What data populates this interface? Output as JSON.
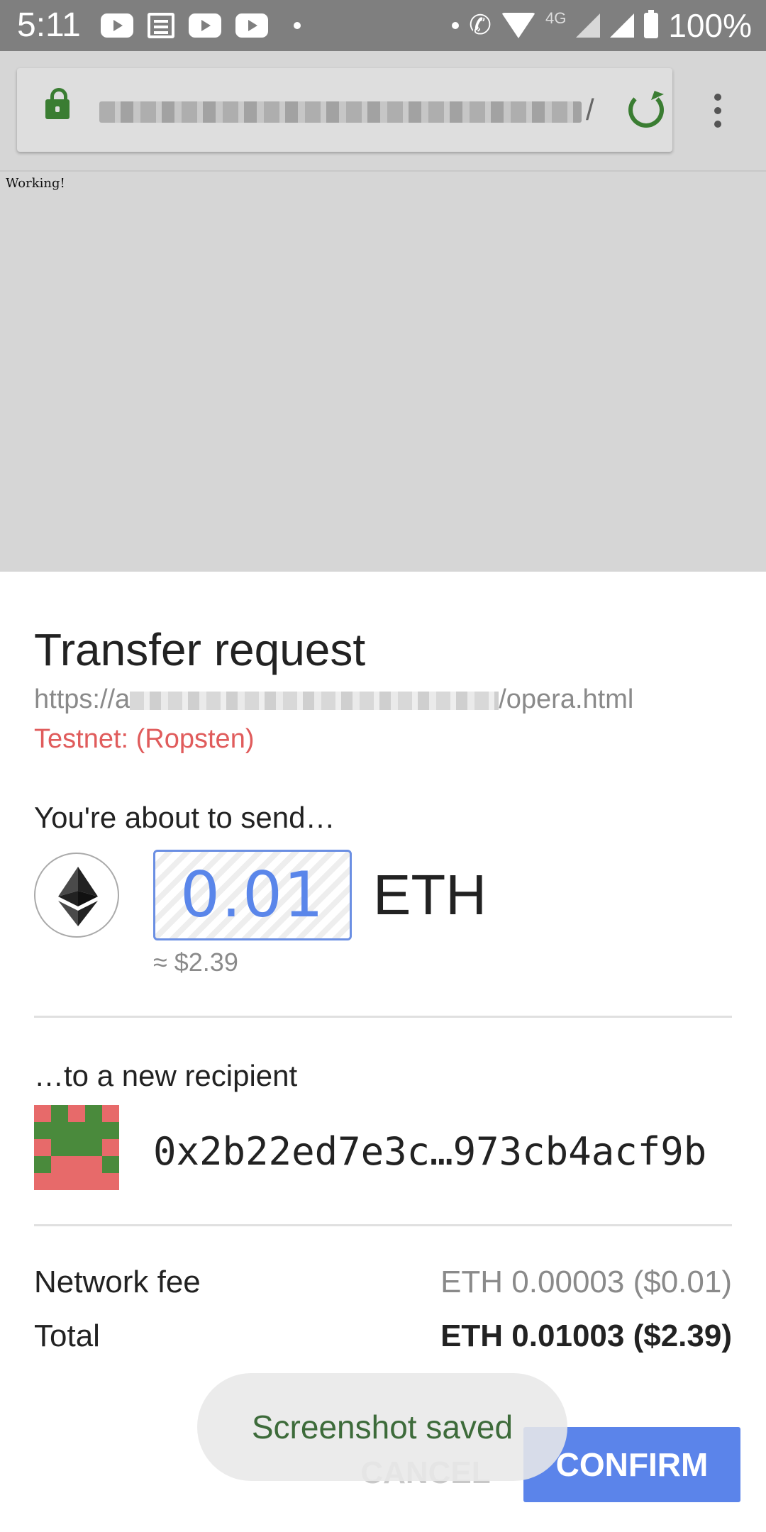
{
  "status_bar": {
    "time": "5:11",
    "network_type": "4G",
    "battery": "100%",
    "icons": [
      "youtube-icon",
      "news-icon",
      "youtube-icon",
      "youtube-icon",
      "dot-icon",
      "dot-icon",
      "wifi-call-icon",
      "wifi-icon",
      "signal-icon",
      "battery-icon"
    ]
  },
  "browser": {
    "url_suffix": "/",
    "secure": true,
    "page_text": "Working!",
    "icons": [
      "lock-icon",
      "reload-icon",
      "more-vert-icon"
    ]
  },
  "transfer": {
    "title": "Transfer request",
    "origin_prefix": "https://a",
    "origin_suffix": "/opera.html",
    "network": "Testnet: (Ropsten)",
    "send_heading": "You're about to send…",
    "amount": "0.01",
    "currency": "ETH",
    "fiat_estimate": "≈ $2.39",
    "recipient_heading": "…to a new recipient",
    "recipient_address": "0x2b22ed7e3c…973cb4acf9b",
    "fee_label": "Network fee",
    "fee_value": "ETH 0.00003 ($0.01)",
    "total_label": "Total",
    "total_value": "ETH 0.01003 ($2.39)",
    "cancel_label": "CANCEL",
    "confirm_label": "CONFIRM"
  },
  "toast": {
    "message": "Screenshot saved"
  },
  "colors": {
    "accent": "#5b84ea",
    "secure_green": "#3a7d32",
    "testnet_red": "#e05c5c",
    "identicon_green": "#4a8a3c",
    "identicon_red": "#e76a6a"
  }
}
